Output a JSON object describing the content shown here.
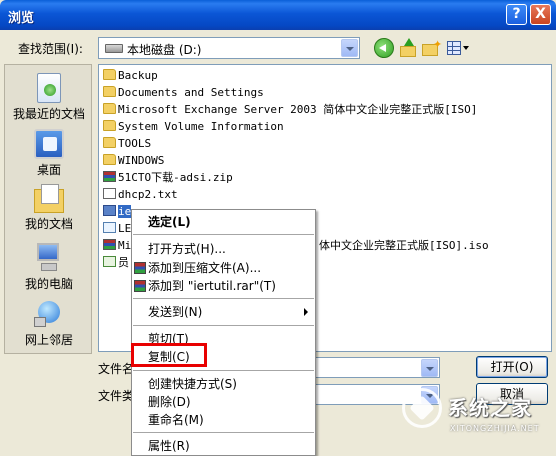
{
  "window": {
    "title": "浏览",
    "help_btn": "?",
    "close_btn": "X"
  },
  "lookin": {
    "label": "查找范围(I):",
    "value": "本地磁盘 (D:)"
  },
  "places": [
    {
      "label": "我最近的文档"
    },
    {
      "label": "桌面"
    },
    {
      "label": "我的文档"
    },
    {
      "label": "我的电脑"
    },
    {
      "label": "网上邻居"
    }
  ],
  "files": [
    {
      "name": "Backup",
      "type": "folder"
    },
    {
      "name": "Documents and Settings",
      "type": "folder"
    },
    {
      "name": "Microsoft Exchange Server 2003 简体中文企业完整正式版[ISO]",
      "type": "folder"
    },
    {
      "name": "System Volume Information",
      "type": "folder"
    },
    {
      "name": "TOOLS",
      "type": "folder"
    },
    {
      "name": "WINDOWS",
      "type": "folder"
    },
    {
      "name": "51CTO下载-adsi.zip",
      "type": "zip"
    },
    {
      "name": "dhcp2.txt",
      "type": "txt"
    },
    {
      "name": "iertutil.dll",
      "type": "selected",
      "visible": "ie"
    },
    {
      "name": "LE",
      "type": "doc"
    },
    {
      "name": "Mi",
      "type": "zip",
      "suffix": "体中文企业完整正式版[ISO].iso"
    },
    {
      "name": "员",
      "type": "grn"
    }
  ],
  "bottom": {
    "filename_label": "文件名",
    "filetype_label": "文件类",
    "open_btn": "打开(O)",
    "cancel_btn": "取消"
  },
  "context_menu": {
    "items": [
      {
        "label": "选定(L)",
        "bold": true
      },
      {
        "label": "打开方式(H)..."
      },
      {
        "label": "添加到压缩文件(A)...",
        "icon": "winrar-icon"
      },
      {
        "label": "添加到 \"iertutil.rar\"(T)",
        "icon": "winrar-icon"
      },
      {
        "label": "发送到(N)",
        "submenu": true
      },
      {
        "label": "剪切(T)"
      },
      {
        "label": "复制(C)"
      },
      {
        "label": "创建快捷方式(S)"
      },
      {
        "label": "删除(D)"
      },
      {
        "label": "重命名(M)"
      },
      {
        "label": "属性(R)"
      }
    ]
  },
  "watermark": {
    "cn": "系统之家",
    "en": "XITONGZHIJIA.NET"
  },
  "colors": {
    "titlebar": "#0b56d6",
    "selection": "#316ac5",
    "highlight": "#e80000",
    "dialog_bg": "#ece9d8"
  }
}
